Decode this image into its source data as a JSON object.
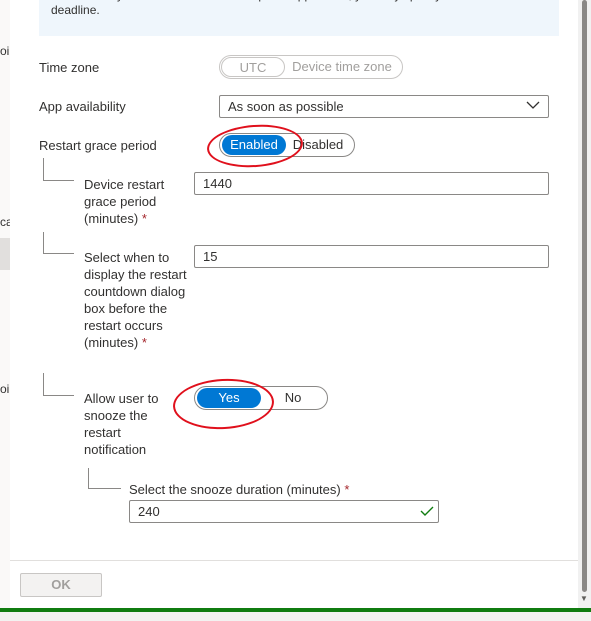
{
  "info_text": "an availability time below. If this is a required application, you may specify the installation deadline.",
  "background_fragments": [
    "oil",
    "ca",
    "oil"
  ],
  "time_zone": {
    "label": "Time zone",
    "options": [
      "UTC",
      "Device time zone"
    ],
    "selected": "UTC"
  },
  "app_availability": {
    "label": "App availability",
    "value": "As soon as possible"
  },
  "restart_grace_period": {
    "label": "Restart grace period",
    "options": [
      "Enabled",
      "Disabled"
    ],
    "selected": "Enabled"
  },
  "device_restart": {
    "label": "Device restart grace period (minutes)",
    "value": "1440",
    "required_marker": "*"
  },
  "countdown": {
    "label": "Select when to display the restart countdown dialog box before the restart occurs (minutes)",
    "value": "15",
    "required_marker": "*"
  },
  "snooze": {
    "label": "Allow user to snooze the restart notification",
    "options": [
      "Yes",
      "No"
    ],
    "selected": "Yes"
  },
  "snooze_duration": {
    "label": "Select the snooze duration (minutes)",
    "value": "240",
    "required_marker": "*"
  },
  "footer": {
    "ok_label": "OK"
  },
  "colors": {
    "accent": "#0078d4",
    "annotation": "#e0101c",
    "valid": "#107c10"
  }
}
